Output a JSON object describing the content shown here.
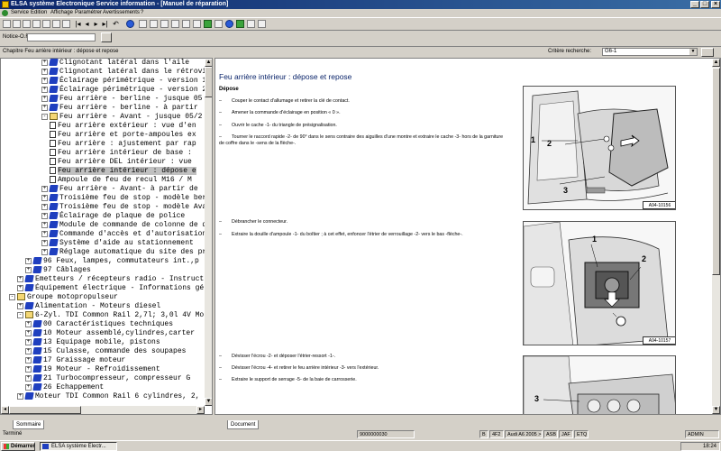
{
  "window": {
    "title": "ELSA système Electronique Service information - [Manuel de réparation]",
    "controls": [
      "_",
      "□",
      "×"
    ]
  },
  "menu": [
    "Service",
    "Edition",
    "Affichage",
    "Paramétrer",
    "Avertissements",
    "?"
  ],
  "toolbar": {
    "buttons": [
      "new-icon",
      "open-icon",
      "save-icon",
      "print-icon",
      "cut-icon",
      "copy-icon",
      "paste-icon",
      "first-icon",
      "prev-icon",
      "next-icon",
      "last-icon",
      "back-icon",
      "info-icon",
      "help-icon",
      "bookmark-icon",
      "camera-icon",
      "window-icon",
      "doc-icon",
      "globe-icon",
      "car-icon",
      "pen-icon",
      "tools-icon",
      "list-icon",
      "refresh-icon",
      "target-icon"
    ]
  },
  "notice": {
    "label": "Notice-O.R.:",
    "value": ""
  },
  "chapter": {
    "text": "Chapitre Feu arrière intérieur : dépose et repose",
    "criteria_label": "Critère recherche:",
    "criteria_value": "G6-1"
  },
  "tree": {
    "rows": [
      {
        "indent": 5,
        "exp": "+",
        "icon": "book",
        "label": "Clignotant latéral dans l'aile"
      },
      {
        "indent": 5,
        "exp": "+",
        "icon": "book",
        "label": "Clignotant latéral dans le rétrovi"
      },
      {
        "indent": 5,
        "exp": "+",
        "icon": "book",
        "label": "Éclairage périmétrique - version 1"
      },
      {
        "indent": 5,
        "exp": "+",
        "icon": "book",
        "label": "Éclairage périmétrique - version 2"
      },
      {
        "indent": 5,
        "exp": "+",
        "icon": "book",
        "label": "Feu arrière - berline - jusque 05"
      },
      {
        "indent": 5,
        "exp": "+",
        "icon": "book",
        "label": "Feu arrière - berline - à partir"
      },
      {
        "indent": 5,
        "exp": "-",
        "icon": "bookopen",
        "label": "Feu arrière - Avant - jusque 05/2"
      },
      {
        "indent": 6,
        "exp": "",
        "icon": "page",
        "label": "Feu arrière extérieur : vue d'en"
      },
      {
        "indent": 6,
        "exp": "",
        "icon": "page",
        "label": "Feu arrière et porte-ampoules ex"
      },
      {
        "indent": 6,
        "exp": "",
        "icon": "page",
        "label": "Feu arrière : ajustement par rap"
      },
      {
        "indent": 6,
        "exp": "",
        "icon": "page",
        "label": "Feu arrière intérieur de base :"
      },
      {
        "indent": 6,
        "exp": "",
        "icon": "page",
        "label": "Feu arrière DEL intérieur : vue"
      },
      {
        "indent": 6,
        "exp": "",
        "icon": "page",
        "label": "Feu arrière intérieur : dépose e",
        "selected": true
      },
      {
        "indent": 6,
        "exp": "",
        "icon": "page",
        "label": "Ampoule de feu de recul  M16 / M"
      },
      {
        "indent": 5,
        "exp": "+",
        "icon": "book",
        "label": "Feu arrière - Avant- à partir de"
      },
      {
        "indent": 5,
        "exp": "+",
        "icon": "book",
        "label": "Troisième feu de stop - modèle ber"
      },
      {
        "indent": 5,
        "exp": "+",
        "icon": "book",
        "label": "Troisième feu de stop - modèle Ava"
      },
      {
        "indent": 5,
        "exp": "+",
        "icon": "book",
        "label": "Éclairage de plaque de police"
      },
      {
        "indent": 5,
        "exp": "+",
        "icon": "book",
        "label": "Module de commande de colonne de d"
      },
      {
        "indent": 5,
        "exp": "+",
        "icon": "book",
        "label": "Commande d'accès et d'autorisation"
      },
      {
        "indent": 5,
        "exp": "+",
        "icon": "book",
        "label": "Système d'aide au stationnement"
      },
      {
        "indent": 5,
        "exp": "+",
        "icon": "book",
        "label": "Réglage automatique du site des pr"
      },
      {
        "indent": 3,
        "exp": "+",
        "icon": "book",
        "label": "96 Feux, lampes, commutateurs int.,p"
      },
      {
        "indent": 3,
        "exp": "+",
        "icon": "book",
        "label": "97 Câblages"
      },
      {
        "indent": 2,
        "exp": "+",
        "icon": "book",
        "label": "Emetteurs / récepteurs radio - Instruct"
      },
      {
        "indent": 2,
        "exp": "+",
        "icon": "book",
        "label": "Équipement électrique - Informations gé"
      },
      {
        "indent": 1,
        "exp": "-",
        "icon": "bookopen",
        "label": "Groupe motopropulseur"
      },
      {
        "indent": 2,
        "exp": "+",
        "icon": "book",
        "label": "Alimentation - Moteurs diesel"
      },
      {
        "indent": 2,
        "exp": "-",
        "icon": "bookopen",
        "label": "6-Zyl. TDI Common Rail 2,7l; 3,0l 4V Mo"
      },
      {
        "indent": 3,
        "exp": "+",
        "icon": "book",
        "label": "00 Caractéristiques techniques"
      },
      {
        "indent": 3,
        "exp": "+",
        "icon": "book",
        "label": "10 Moteur assemblé,cylindres,carter"
      },
      {
        "indent": 3,
        "exp": "+",
        "icon": "book",
        "label": "13 Equipage mobile, pistons"
      },
      {
        "indent": 3,
        "exp": "+",
        "icon": "book",
        "label": "15 Culasse, commande des soupapes"
      },
      {
        "indent": 3,
        "exp": "+",
        "icon": "book",
        "label": "17 Graissage moteur"
      },
      {
        "indent": 3,
        "exp": "+",
        "icon": "book",
        "label": "19 Moteur - Refroidissement"
      },
      {
        "indent": 3,
        "exp": "+",
        "icon": "book",
        "label": "21 Turbocompresseur, compresseur G"
      },
      {
        "indent": 3,
        "exp": "+",
        "icon": "book",
        "label": "26 Echappement"
      },
      {
        "indent": 2,
        "exp": "+",
        "icon": "book",
        "label": "Moteur TDI Common Rail 6 cylindres, 2,"
      }
    ],
    "tab": "Sommaire"
  },
  "document": {
    "title": "Feu arrière intérieur : dépose et repose",
    "section": "Dépose",
    "steps_group1": [
      "Couper le contact d'allumage et retirer la clé de contact.",
      "Amener la commande d'éclairage en position « 0 ».",
      "Ouvrir le cache -1- du triangle de présignalisation.",
      "Tourner le raccord rapide -2- de 90° dans le sens contraire des aiguilles d'une montre et extraire le cache -3- hors de la garniture de coffre dans le -sens de la flèche-."
    ],
    "steps_group2": [
      "Débrancher le connecteur.",
      "Extraire la douille d'ampoule -1- du boîtier ; à cet effet, enfoncer l'étrier de verrouillage -2- vers le bas -flèche-."
    ],
    "steps_group3": [
      "Dévisser l'écrou -2- et déposer l'étrier-ressort -1-.",
      "Dévisser l'écrou -4- et retirer le feu arrière intérieur -3- vers l'extérieur.",
      "Extraire le support de serrage -5- de la baie de carrosserie."
    ],
    "figure1": {
      "id": "A94-10156",
      "callouts": [
        "1",
        "2",
        "3"
      ]
    },
    "figure2": {
      "id": "A94-10157",
      "callouts": [
        "1",
        "2"
      ]
    },
    "figure3": {
      "callouts": [
        "3"
      ]
    },
    "tab": "Document"
  },
  "status": {
    "left": "Terminé",
    "code": "9000000030",
    "b": "B",
    "mark": "4F2",
    "model": "Audi A6 2005 >",
    "engine": "ASB",
    "gear": "JAF",
    "etq": "ETQ",
    "user": "ADMIN"
  },
  "taskbar": {
    "start": "Démarrer",
    "task": "ELSA système Electr...",
    "clock": "18:24"
  }
}
